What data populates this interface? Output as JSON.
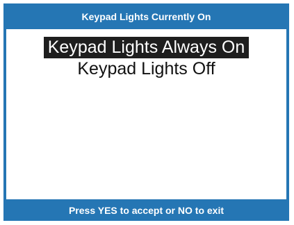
{
  "header": {
    "title": "Keypad Lights Currently On"
  },
  "menu": {
    "items": [
      {
        "label": "Keypad Lights Always On",
        "selected": true
      },
      {
        "label": "Keypad Lights Off",
        "selected": false
      }
    ]
  },
  "footer": {
    "instruction": "Press YES to accept or NO to exit"
  },
  "colors": {
    "frame": "#2576b4",
    "selected_background": "#1e1e1e",
    "selected_text": "#ffffff",
    "body_background": "#ffffff"
  }
}
